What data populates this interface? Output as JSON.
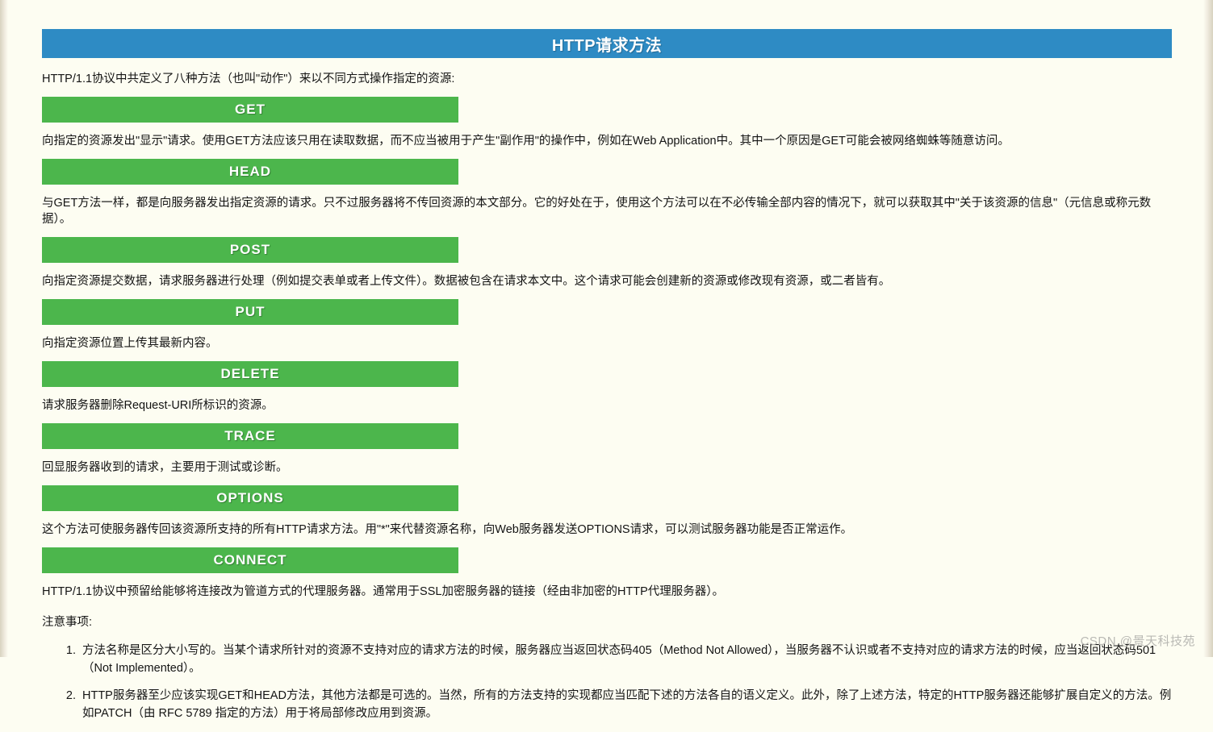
{
  "header": {
    "title": "HTTP请求方法",
    "bar_color": "#2e8bc4"
  },
  "intro": "HTTP/1.1协议中共定义了八种方法（也叫\"动作\"）来以不同方式操作指定的资源:",
  "method_bar_color": "#4cb64c",
  "methods": [
    {
      "name": "GET",
      "desc": "向指定的资源发出\"显示\"请求。使用GET方法应该只用在读取数据，而不应当被用于产生\"副作用\"的操作中，例如在Web Application中。其中一个原因是GET可能会被网络蜘蛛等随意访问。"
    },
    {
      "name": "HEAD",
      "desc": "与GET方法一样，都是向服务器发出指定资源的请求。只不过服务器将不传回资源的本文部分。它的好处在于，使用这个方法可以在不必传输全部内容的情况下，就可以获取其中\"关于该资源的信息\"（元信息或称元数据）。"
    },
    {
      "name": "POST",
      "desc": "向指定资源提交数据，请求服务器进行处理（例如提交表单或者上传文件）。数据被包含在请求本文中。这个请求可能会创建新的资源或修改现有资源，或二者皆有。"
    },
    {
      "name": "PUT",
      "desc": "向指定资源位置上传其最新内容。"
    },
    {
      "name": "DELETE",
      "desc": "请求服务器删除Request-URI所标识的资源。"
    },
    {
      "name": "TRACE",
      "desc": "回显服务器收到的请求，主要用于测试或诊断。"
    },
    {
      "name": "OPTIONS",
      "desc": "这个方法可使服务器传回该资源所支持的所有HTTP请求方法。用\"*\"来代替资源名称，向Web服务器发送OPTIONS请求，可以测试服务器功能是否正常运作。"
    },
    {
      "name": "CONNECT",
      "desc": "HTTP/1.1协议中预留给能够将连接改为管道方式的代理服务器。通常用于SSL加密服务器的链接（经由非加密的HTTP代理服务器）。"
    }
  ],
  "notes_title": "注意事项:",
  "notes": [
    "方法名称是区分大小写的。当某个请求所针对的资源不支持对应的请求方法的时候，服务器应当返回状态码405（Method Not Allowed），当服务器不认识或者不支持对应的请求方法的时候，应当返回状态码501（Not Implemented）。",
    "HTTP服务器至少应该实现GET和HEAD方法，其他方法都是可选的。当然，所有的方法支持的实现都应当匹配下述的方法各自的语义定义。此外，除了上述方法，特定的HTTP服务器还能够扩展自定义的方法。例如PATCH（由 RFC 5789 指定的方法）用于将局部修改应用到资源。"
  ],
  "watermark": "CSDN @景天科技苑"
}
